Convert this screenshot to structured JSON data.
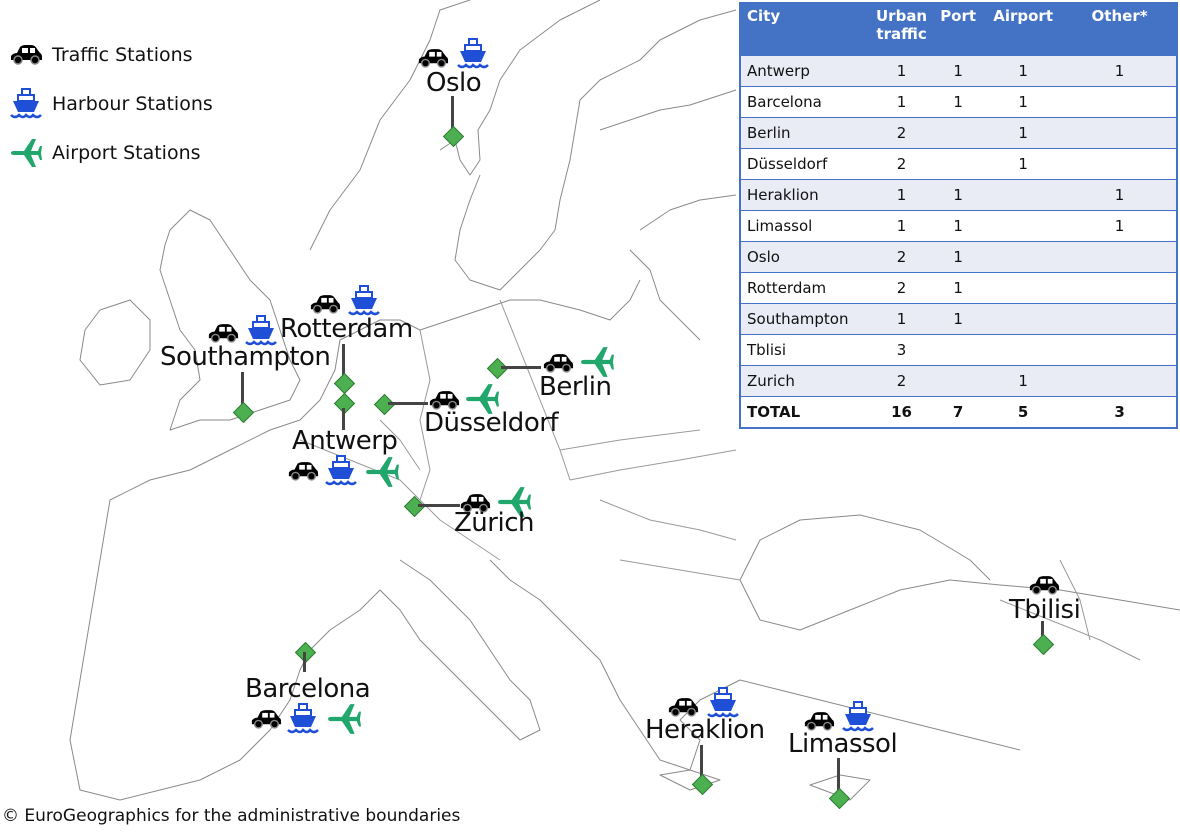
{
  "legend": [
    {
      "icon": "car-icon",
      "label": "Traffic Stations"
    },
    {
      "icon": "ship-icon",
      "label": "Harbour Stations"
    },
    {
      "icon": "airplane-icon",
      "label": "Airport Stations"
    }
  ],
  "colors": {
    "car": "#000000",
    "ship": "#1f4fd6",
    "airplane": "#21a66b",
    "marker": "#4caf50",
    "table_header": "#4472c4",
    "table_band": "#e9ebf5"
  },
  "cities": {
    "oslo": {
      "name": "Oslo",
      "icons": [
        "car-icon",
        "ship-icon"
      ]
    },
    "rotterdam": {
      "name": "Rotterdam",
      "icons": [
        "car-icon",
        "ship-icon"
      ]
    },
    "southampton": {
      "name": "Southampton",
      "icons": [
        "car-icon",
        "ship-icon"
      ]
    },
    "antwerp": {
      "name": "Antwerp",
      "icons": [
        "car-icon",
        "ship-icon",
        "airplane-icon"
      ]
    },
    "dusseldorf": {
      "name": "Düsseldorf",
      "icons": [
        "car-icon",
        "airplane-icon"
      ]
    },
    "berlin": {
      "name": "Berlin",
      "icons": [
        "car-icon",
        "airplane-icon"
      ]
    },
    "zurich": {
      "name": "Zürich",
      "icons": [
        "car-icon",
        "airplane-icon"
      ]
    },
    "barcelona": {
      "name": "Barcelona",
      "icons": [
        "car-icon",
        "ship-icon",
        "airplane-icon"
      ]
    },
    "heraklion": {
      "name": "Heraklion",
      "icons": [
        "car-icon",
        "ship-icon"
      ]
    },
    "limassol": {
      "name": "Limassol",
      "icons": [
        "car-icon",
        "ship-icon"
      ]
    },
    "tbilisi": {
      "name": "Tbilisi",
      "icons": [
        "car-icon"
      ]
    }
  },
  "table": {
    "headers": [
      "City",
      "Urban traffic",
      "Port",
      "Airport",
      "Other*"
    ],
    "rows": [
      [
        "Antwerp",
        "1",
        "1",
        "1",
        "1"
      ],
      [
        "Barcelona",
        "1",
        "1",
        "1",
        ""
      ],
      [
        "Berlin",
        "2",
        "",
        "1",
        ""
      ],
      [
        "Düsseldorf",
        "2",
        "",
        "1",
        ""
      ],
      [
        "Heraklion",
        "1",
        "1",
        "",
        "1"
      ],
      [
        "Limassol",
        "1",
        "1",
        "",
        "1"
      ],
      [
        "Oslo",
        "2",
        "1",
        "",
        ""
      ],
      [
        "Rotterdam",
        "2",
        "1",
        "",
        ""
      ],
      [
        "Southampton",
        "1",
        "1",
        "",
        ""
      ],
      [
        "Tblisi",
        "3",
        "",
        "",
        ""
      ],
      [
        "Zurich",
        "2",
        "",
        "1",
        ""
      ]
    ],
    "total": [
      "TOTAL",
      "16",
      "7",
      "5",
      "3"
    ]
  },
  "copyright": "© EuroGeographics for the administrative boundaries"
}
